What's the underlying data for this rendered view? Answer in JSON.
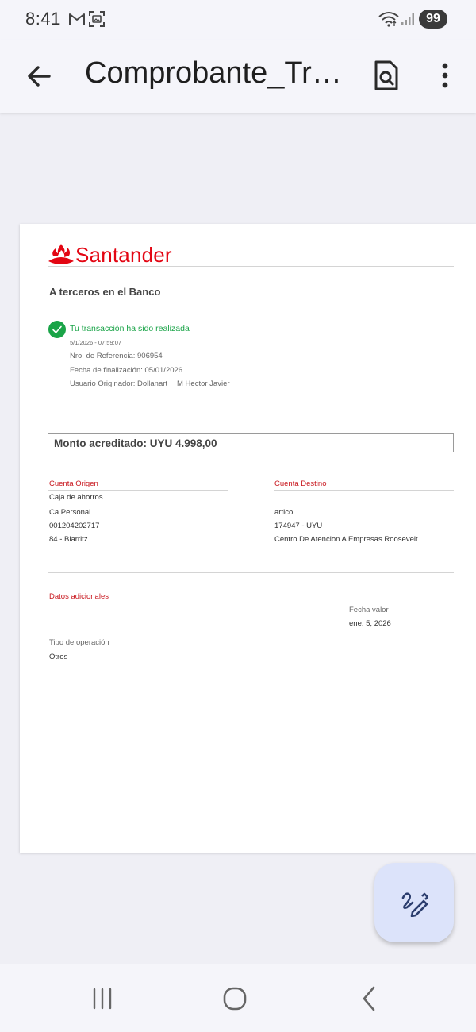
{
  "status_bar": {
    "time": "8:41",
    "battery": "99",
    "icons": [
      "gmail-icon",
      "screenshot-icon",
      "wifi-icon",
      "signal-icon"
    ]
  },
  "app_bar": {
    "title": "Comprobante_Transferencia",
    "icons": [
      "back-arrow-icon",
      "document-search-icon",
      "more-vertical-icon"
    ]
  },
  "document": {
    "bank_name": "Santander",
    "brand_color": "#e30613",
    "transfer_type": "A terceros en el Banco",
    "success_message": "Tu transacción ha sido realizada",
    "success_color": "#1aa448",
    "timestamp": "5/1/2026 - 07:59:07",
    "reference": "Nro. de Referencia: 906954",
    "finalization_date": "Fecha de finalización: 05/01/2026",
    "originator_label": "Usuario Originador: Dollanart",
    "originator_name": "M Hector Javier",
    "amount_label": "Monto acreditado:",
    "amount_value": "UYU 4.998,00",
    "origin": {
      "label": "Cuenta Origen",
      "account_type": "Caja de ahorros",
      "account_name": "Ca Personal",
      "account_number": "001204202717",
      "branch": "84 - Biarritz"
    },
    "destination": {
      "label": "Cuenta Destino",
      "account_name": "artico",
      "account_number": "174947 - UYU",
      "branch": "Centro De Atencion A Empresas Roosevelt"
    },
    "additional": {
      "label": "Datos adicionales",
      "value_date_label": "Fecha valor",
      "value_date": "ene. 5, 2026",
      "operation_type_label": "Tipo de operación",
      "operation_type": "Otros"
    }
  },
  "fab": {
    "icon": "edit-sign-icon"
  },
  "nav_bar": {
    "icons": [
      "recent-apps-icon",
      "home-icon",
      "back-icon"
    ]
  }
}
